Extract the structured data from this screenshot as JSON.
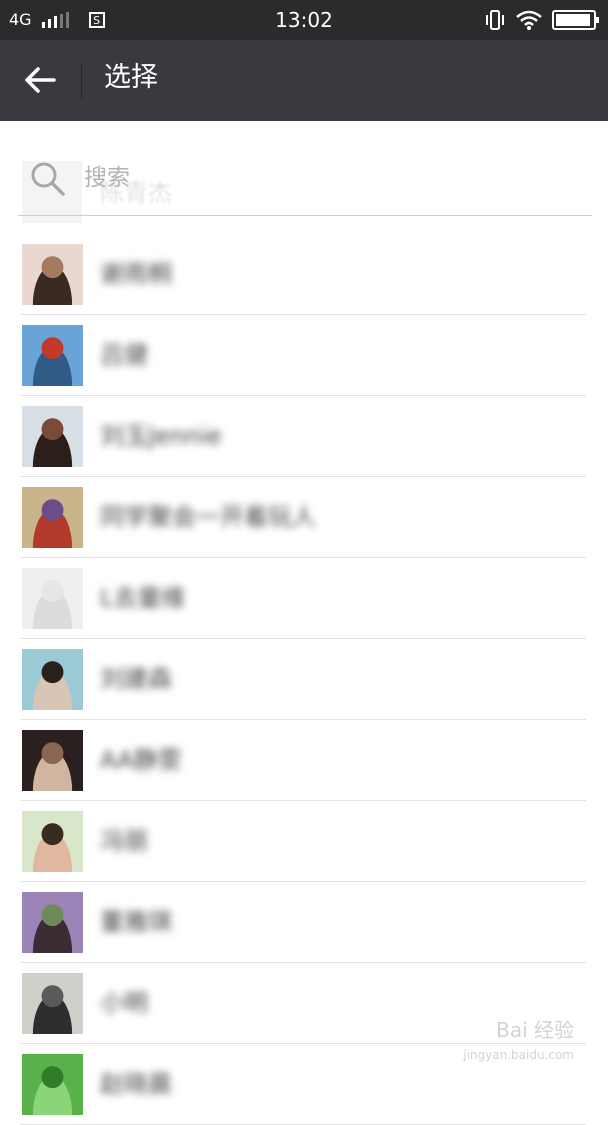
{
  "status_bar": {
    "network": "4G",
    "s_icon": "S",
    "time": "13:02",
    "battery_level": 0.95
  },
  "app_bar": {
    "back_icon": "arrow-left-icon",
    "title": "选择"
  },
  "search": {
    "placeholder": "搜索",
    "icon": "search-icon",
    "peek_name": "陈青杰"
  },
  "contacts": [
    {
      "name": "谢雨桐",
      "avatar_colors": [
        "#e9d8cf",
        "#a57a63",
        "#3a2a22"
      ]
    },
    {
      "name": "吕健",
      "avatar_colors": [
        "#6aa3d8",
        "#c23a2a",
        "#2f5b86"
      ]
    },
    {
      "name": "刘玉Jennie",
      "avatar_colors": [
        "#d9dfe6",
        "#7a4a3a",
        "#2a1f1a"
      ]
    },
    {
      "name": "同学聚会一开着玩人",
      "avatar_colors": [
        "#c9b48c",
        "#6b4d8a",
        "#b23a2a"
      ]
    },
    {
      "name": "L去童维",
      "avatar_colors": [
        "#efefef",
        "#e6e6e6",
        "#dcdcdc"
      ]
    },
    {
      "name": "刘建森",
      "avatar_colors": [
        "#9cc9d6",
        "#2a1f1a",
        "#d9c5b5"
      ]
    },
    {
      "name": "AA静雯",
      "avatar_colors": [
        "#2a2020",
        "#8a6655",
        "#d0b5a0"
      ]
    },
    {
      "name": "冯丽",
      "avatar_colors": [
        "#d8e6c9",
        "#3a2a20",
        "#e0b8a0"
      ]
    },
    {
      "name": "董雅琪",
      "avatar_colors": [
        "#9b84b8",
        "#6e8a5a",
        "#3b2b33"
      ]
    },
    {
      "name": "小明",
      "avatar_colors": [
        "#cfd0ca",
        "#5a5a5a",
        "#2e2e2e"
      ]
    },
    {
      "name": "赵晓晨",
      "avatar_colors": [
        "#5ab04a",
        "#2f7d2a",
        "#8bd47a"
      ]
    }
  ],
  "watermark": {
    "main": "Bai 经验",
    "sub": "jingyan.baidu.com"
  }
}
